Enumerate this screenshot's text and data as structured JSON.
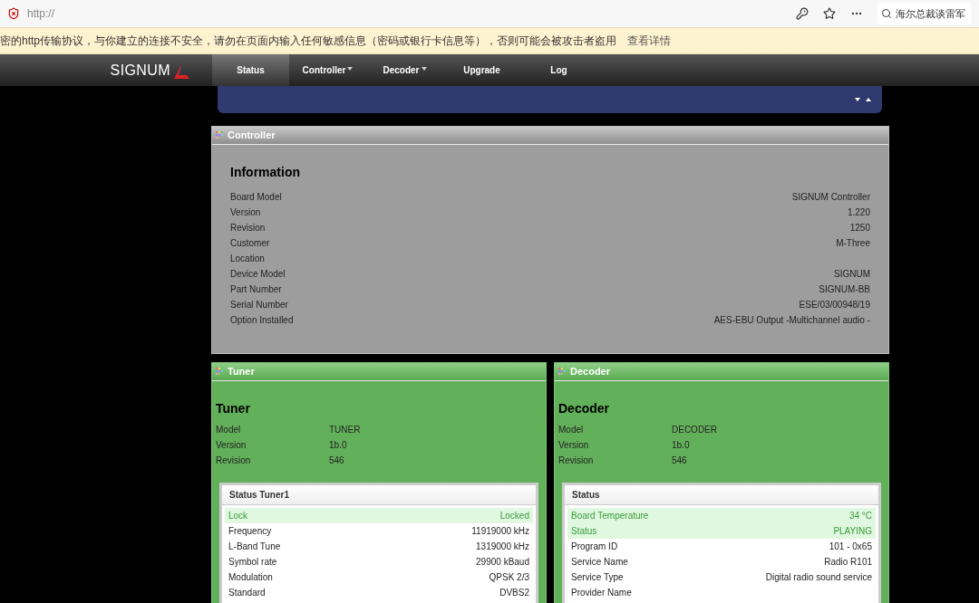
{
  "browser": {
    "url": "http://",
    "search_placeholder": "海尔总裁谈雷军"
  },
  "banner": {
    "text": "密的http传输协议，与你建立的连接不安全，请勿在页面内输入任何敏感信息（密码或银行卡信息等），否则可能会被攻击者盗用",
    "link": "查看详情"
  },
  "nav": {
    "logo": "SIGNUM",
    "items": [
      {
        "label": "Status",
        "selected": true,
        "dropdown": false
      },
      {
        "label": "Controller",
        "selected": false,
        "dropdown": true
      },
      {
        "label": "Decoder",
        "selected": false,
        "dropdown": true
      },
      {
        "label": "Upgrade",
        "selected": false,
        "dropdown": false
      },
      {
        "label": "Log",
        "selected": false,
        "dropdown": false
      }
    ]
  },
  "controller": {
    "title": "Controller",
    "heading": "Information",
    "rows": [
      {
        "label": "Board Model",
        "value": "SIGNUM Controller"
      },
      {
        "label": "Version",
        "value": "1.220"
      },
      {
        "label": "Revision",
        "value": "1250"
      },
      {
        "label": "Customer",
        "value": "M-Three"
      },
      {
        "label": "Location",
        "value": ""
      },
      {
        "label": "Device Model",
        "value": "SIGNUM"
      },
      {
        "label": "Part Number",
        "value": "SIGNUM-BB"
      },
      {
        "label": "Serial Number",
        "value": "ESE/03/00948/19"
      },
      {
        "label": "Option Installed",
        "value": "AES-EBU Output -Multichannel audio -"
      }
    ]
  },
  "panels": [
    {
      "title": "Tuner",
      "heading": "Tuner",
      "info": [
        {
          "label": "Model",
          "value": "TUNER"
        },
        {
          "label": "Version",
          "value": "1b.0"
        },
        {
          "label": "Revision",
          "value": "546"
        }
      ],
      "status": {
        "title": "Status Tuner1",
        "rows": [
          {
            "label": "Lock",
            "value": "Locked",
            "highlighted": true
          },
          {
            "label": "Frequency",
            "value": "11919000 kHz",
            "highlighted": false
          },
          {
            "label": "L-Band Tune",
            "value": "1319000 kHz",
            "highlighted": false
          },
          {
            "label": "Symbol rate",
            "value": "29900 kBaud",
            "highlighted": false
          },
          {
            "label": "Modulation",
            "value": "QPSK 2/3",
            "highlighted": false
          },
          {
            "label": "Standard",
            "value": "DVBS2",
            "highlighted": false
          }
        ]
      }
    },
    {
      "title": "Decoder",
      "heading": "Decoder",
      "info": [
        {
          "label": "Model",
          "value": "DECODER"
        },
        {
          "label": "Version",
          "value": "1b.0"
        },
        {
          "label": "Revision",
          "value": "546"
        }
      ],
      "status": {
        "title": "Status",
        "rows": [
          {
            "label": "Board Temperature",
            "value": "34 °C",
            "highlighted": true
          },
          {
            "label": "Status",
            "value": "PLAYING",
            "highlighted": true
          },
          {
            "label": "Program ID",
            "value": "101 - 0x65",
            "highlighted": false
          },
          {
            "label": "Service Name",
            "value": "Radio R101",
            "highlighted": false
          },
          {
            "label": "Service Type",
            "value": "Digital radio sound service",
            "highlighted": false
          },
          {
            "label": "Provider Name",
            "value": "",
            "highlighted": false
          }
        ]
      }
    }
  ]
}
